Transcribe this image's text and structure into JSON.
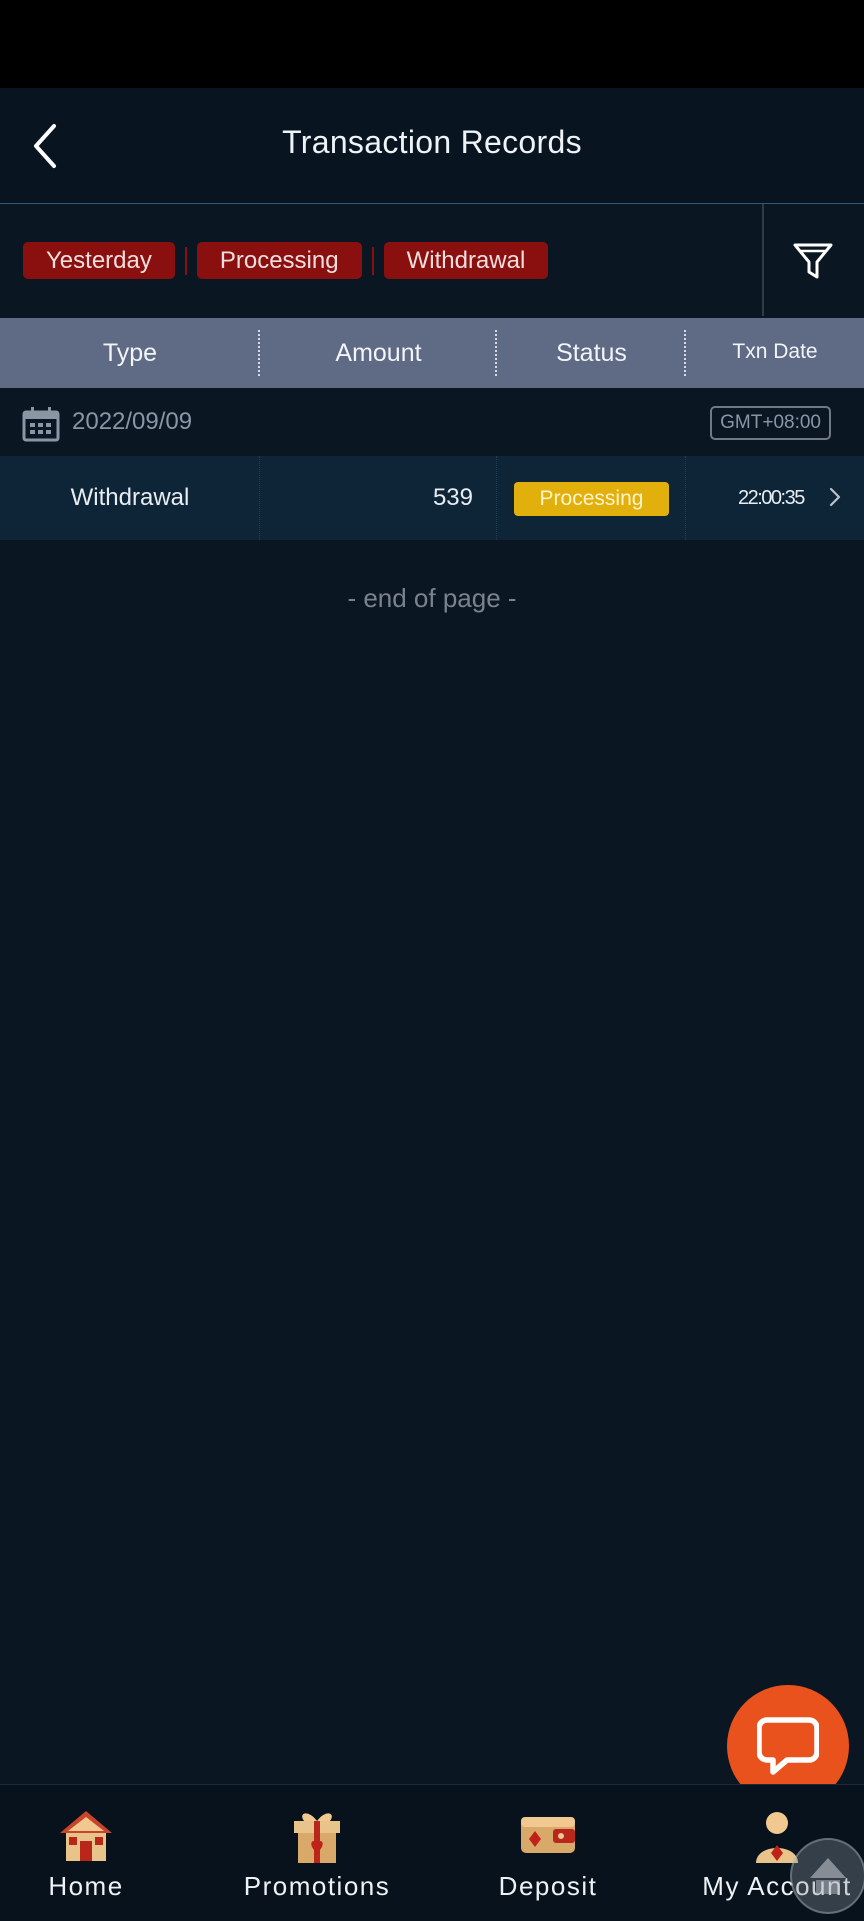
{
  "header": {
    "title": "Transaction Records"
  },
  "filters": {
    "chips": [
      "Yesterday",
      "Processing",
      "Withdrawal"
    ]
  },
  "table": {
    "columns": [
      "Type",
      "Amount",
      "Status",
      "Txn Date"
    ],
    "date_group": {
      "date": "2022/09/09",
      "timezone": "GMT+08:00"
    },
    "rows": [
      {
        "type": "Withdrawal",
        "amount": "539",
        "status": "Processing",
        "time": "22:00:35"
      }
    ],
    "end_text": "-  end of page  -"
  },
  "tabbar": {
    "items": [
      {
        "label": "Home",
        "icon": "home-icon"
      },
      {
        "label": "Promotions",
        "icon": "gift-icon"
      },
      {
        "label": "Deposit",
        "icon": "wallet-icon"
      },
      {
        "label": "My Account",
        "icon": "user-icon"
      }
    ]
  },
  "colors": {
    "background": "#0a1622",
    "chip": "#8a1010",
    "header_row": "#5f6a85",
    "status_processing": "#e2b00c",
    "chat_button": "#e9521c"
  }
}
